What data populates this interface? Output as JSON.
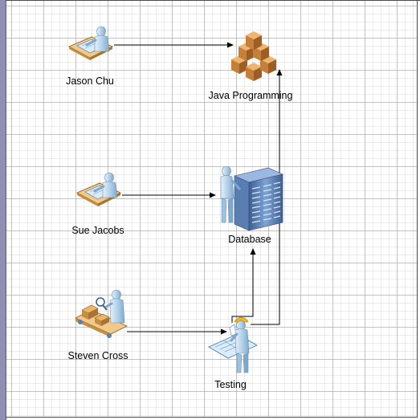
{
  "nodes": {
    "jason_chu": {
      "label": "Jason Chu",
      "icon": "person-at-desk-icon"
    },
    "sue_jacobs": {
      "label": "Sue Jacobs",
      "icon": "person-at-desk-icon"
    },
    "steven_cross": {
      "label": "Steven Cross",
      "icon": "person-at-conveyor-icon"
    },
    "java_programming": {
      "label": "Java Programming",
      "icon": "boxes-stack-icon"
    },
    "database": {
      "label": "Database",
      "icon": "server-rack-with-person-icon"
    },
    "testing": {
      "label": "Testing",
      "icon": "engineer-with-blueprint-icon"
    }
  },
  "connectors": [
    {
      "from": "Jason Chu",
      "to": "Java Programming"
    },
    {
      "from": "Sue Jacobs",
      "to": "Database"
    },
    {
      "from": "Steven Cross",
      "to": "Testing"
    },
    {
      "from": "Testing",
      "to": "Database"
    },
    {
      "from": "Testing",
      "to": "Java Programming"
    }
  ],
  "colors": {
    "ruler": "#8f8fb5",
    "skin": "#b9d5e9",
    "desk": "#f2c98a",
    "blueprint": "#d8ecfa",
    "box": "#d0883a",
    "rack": "#5a7eb0",
    "hardhat": "#f2b21b",
    "connector": "#000000"
  }
}
